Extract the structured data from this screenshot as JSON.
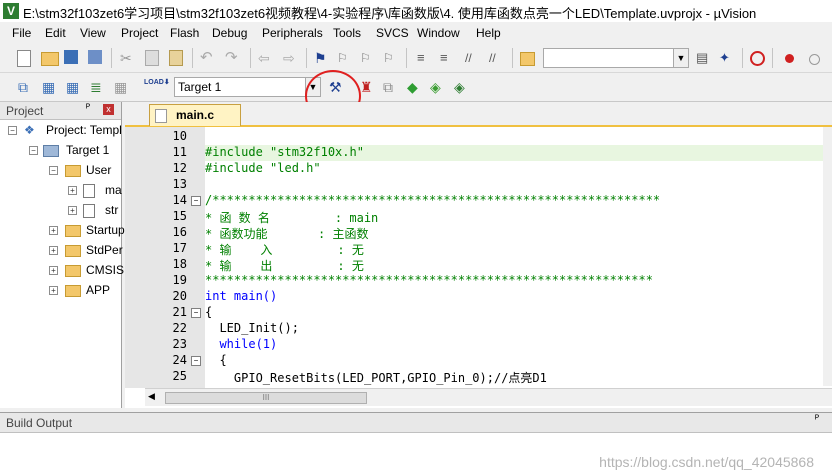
{
  "window": {
    "app_logo": "V",
    "title": "E:\\stm32f103zet6学习项目\\stm32f103zet6视频教程\\4-实验程序\\库函数版\\4. 使用库函数点亮一个LED\\Template.uvprojx - µVision"
  },
  "menubar": [
    "File",
    "Edit",
    "View",
    "Project",
    "Flash",
    "Debug",
    "Peripherals",
    "Tools",
    "SVCS",
    "Window",
    "Help"
  ],
  "toolbar": {
    "target_select": "Target 1",
    "find_combo": "",
    "load_icon_text": "LOAD"
  },
  "project_pane": {
    "title": "Project",
    "pin": "ᴾ",
    "close": "x",
    "tree": [
      {
        "label": "Project: Templ",
        "level": 0
      },
      {
        "label": "Target 1",
        "level": 1
      },
      {
        "label": "User",
        "level": 2
      },
      {
        "label": "ma",
        "level": 3
      },
      {
        "label": "str",
        "level": 3
      },
      {
        "label": "Startup",
        "level": 2
      },
      {
        "label": "StdPer",
        "level": 2
      },
      {
        "label": "CMSIS",
        "level": 2
      },
      {
        "label": "APP",
        "level": 2
      }
    ]
  },
  "editor": {
    "tab": "main.c",
    "lines": [
      {
        "n": "10",
        "text": ""
      },
      {
        "n": "11",
        "text": "#include \"stm32f10x.h\""
      },
      {
        "n": "12",
        "text": "#include \"led.h\""
      },
      {
        "n": "13",
        "text": ""
      },
      {
        "n": "14",
        "text": "/**************************************************************"
      },
      {
        "n": "15",
        "text": "* 函 数 名         : main"
      },
      {
        "n": "16",
        "text": "* 函数功能       : 主函数"
      },
      {
        "n": "17",
        "text": "* 输    入         : 无"
      },
      {
        "n": "18",
        "text": "* 输    出         : 无"
      },
      {
        "n": "19",
        "text": "**************************************************************"
      },
      {
        "n": "20",
        "text": "int main()"
      },
      {
        "n": "21",
        "text": "{"
      },
      {
        "n": "22",
        "text": "  LED_Init();"
      },
      {
        "n": "23",
        "text": "  while(1)"
      },
      {
        "n": "24",
        "text": "  {"
      },
      {
        "n": "25",
        "text": "    GPIO_ResetBits(LED_PORT,GPIO_Pin_0);//点亮D1"
      }
    ],
    "scroll_grip": "III"
  },
  "build_output": {
    "title": "Build Output",
    "pin": "ᴾ"
  },
  "watermark": "https://blog.csdn.net/qq_42045868",
  "colors": {
    "keyword": "#0000ff",
    "preprocessor": "#008000",
    "comment": "#008000",
    "annotation": "#e02020",
    "tab_accent": "#f0c040"
  }
}
